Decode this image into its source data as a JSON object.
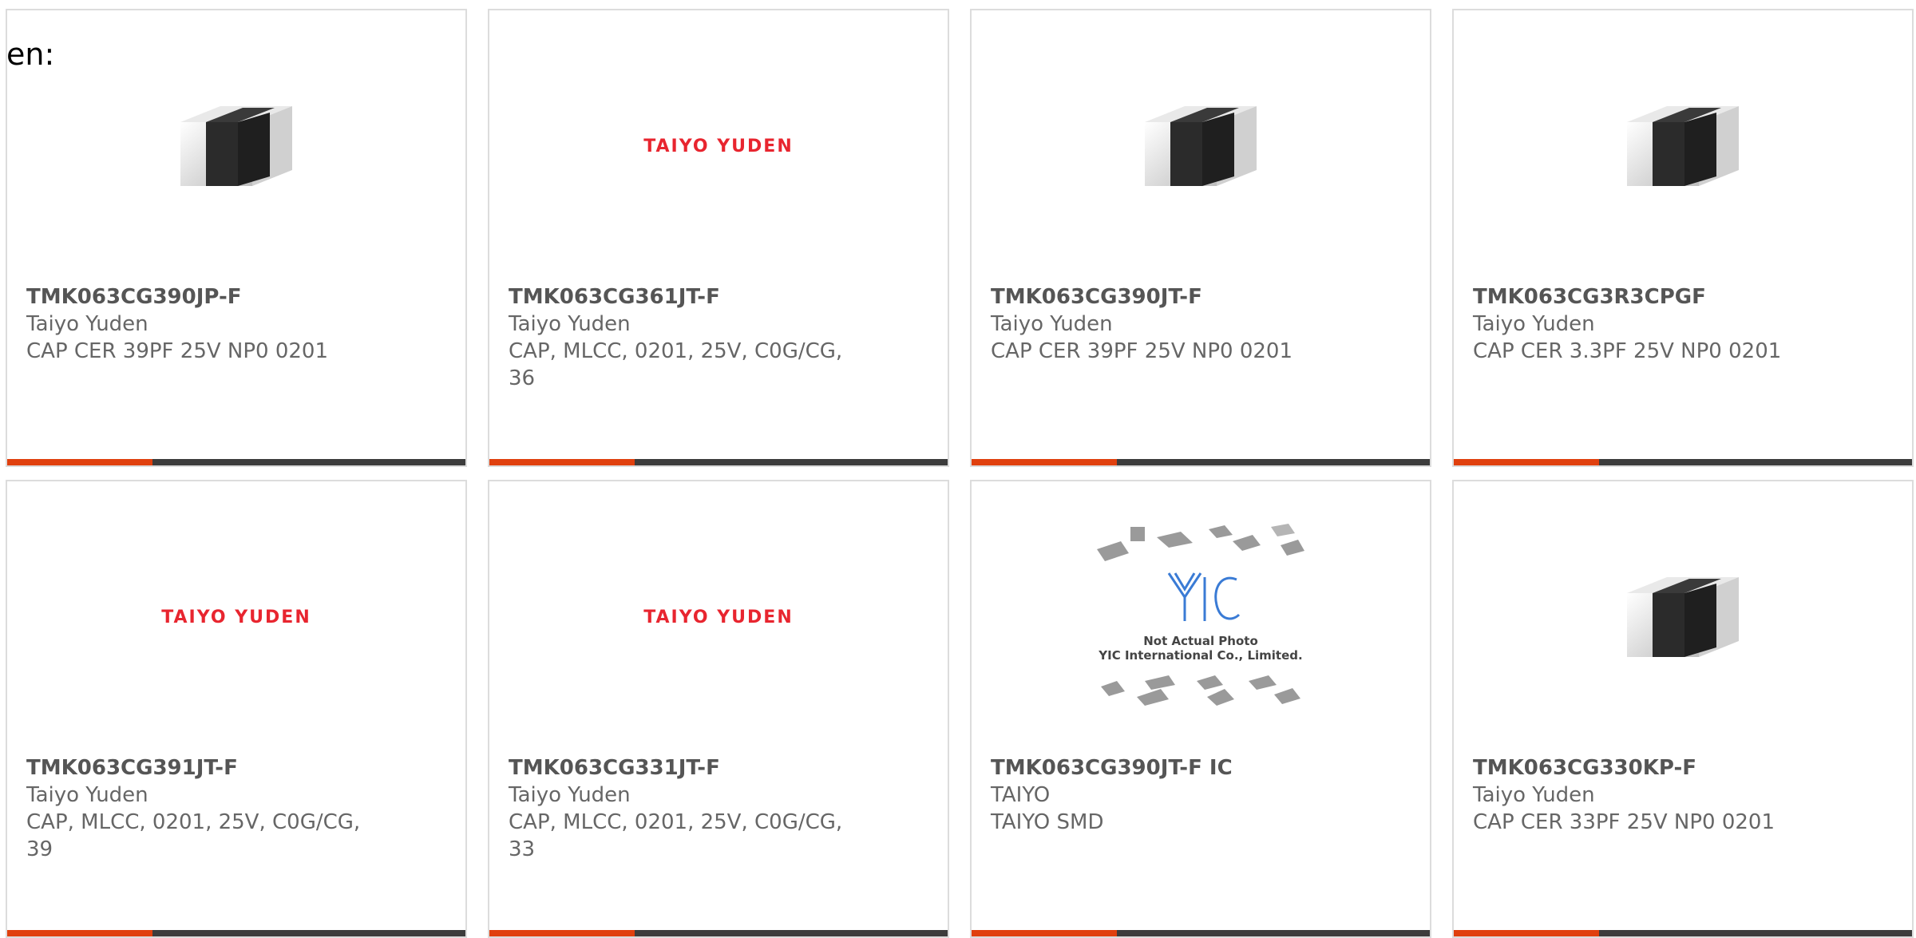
{
  "header": {
    "lang_label": "en:"
  },
  "products": [
    {
      "part_number": "TMK063CG390JP-F",
      "manufacturer": "Taiyo Yuden",
      "description": "CAP CER 39PF 25V NP0 0201",
      "image": "chip-capacitor"
    },
    {
      "part_number": "TMK063CG361JT-F",
      "manufacturer": "Taiyo Yuden",
      "description": "CAP, MLCC, 0201, 25V, C0G/CG, 36",
      "image": "taiyo-yuden-logo",
      "logo_text": "TAIYO YUDEN"
    },
    {
      "part_number": "TMK063CG390JT-F",
      "manufacturer": "Taiyo Yuden",
      "description": "CAP CER 39PF 25V NP0 0201",
      "image": "chip-capacitor"
    },
    {
      "part_number": "TMK063CG3R3CPGF",
      "manufacturer": "Taiyo Yuden",
      "description": "CAP CER 3.3PF 25V NP0 0201",
      "image": "chip-capacitor"
    },
    {
      "part_number": "TMK063CG391JT-F",
      "manufacturer": "Taiyo Yuden",
      "description": "CAP, MLCC, 0201, 25V, C0G/CG, 39",
      "image": "taiyo-yuden-logo",
      "logo_text": "TAIYO YUDEN"
    },
    {
      "part_number": "TMK063CG331JT-F",
      "manufacturer": "Taiyo Yuden",
      "description": "CAP, MLCC, 0201, 25V, C0G/CG, 33",
      "image": "taiyo-yuden-logo",
      "logo_text": "TAIYO YUDEN"
    },
    {
      "part_number": "TMK063CG390JT-F IC",
      "manufacturer": "TAIYO",
      "description": "TAIYO SMD",
      "image": "yic-placeholder",
      "placeholder_line1": "Not Actual Photo",
      "placeholder_line2": "YIC International Co., Limited."
    },
    {
      "part_number": "TMK063CG330KP-F",
      "manufacturer": "Taiyo Yuden",
      "description": "CAP CER 33PF 25V NP0 0201",
      "image": "chip-capacitor"
    }
  ],
  "colors": {
    "accent": "#e0400e",
    "bar": "#3c3c3c",
    "border": "#dcdcdc",
    "logo_red": "#e8252f"
  }
}
